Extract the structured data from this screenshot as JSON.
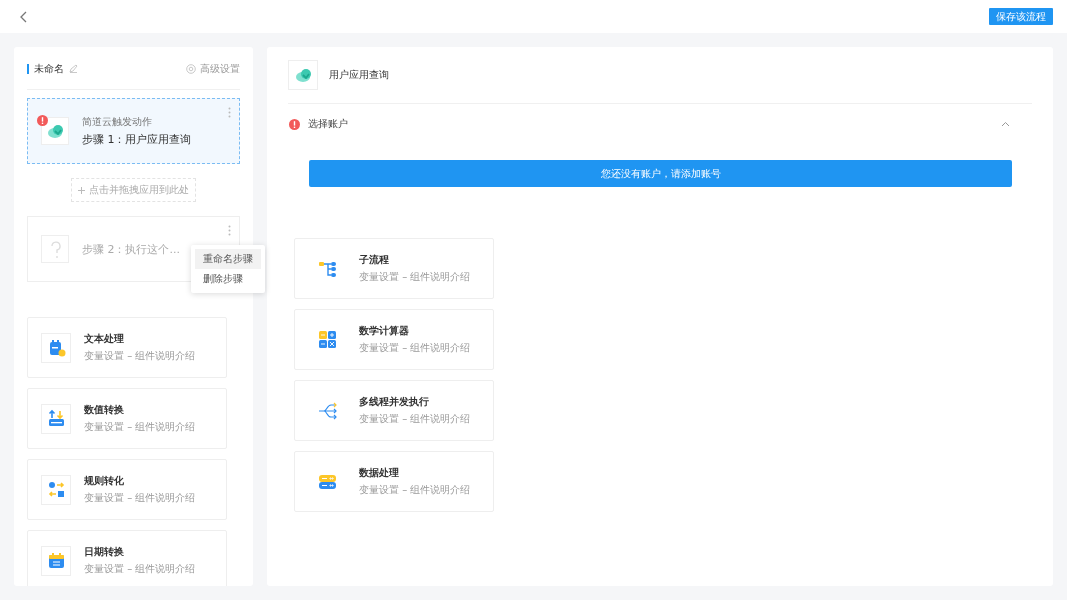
{
  "header": {
    "save_button": "保存该流程"
  },
  "flow": {
    "name": "未命名",
    "settings_link": "高级设置",
    "steps": [
      {
        "kind": "app",
        "subtitle": "简道云触发动作",
        "title": "步骤 1：用户应用查询",
        "selected": true,
        "error": true
      },
      {
        "kind": "empty",
        "title": "步骤 2：执行这个...",
        "selected": false,
        "error": false,
        "menu": [
          {
            "label": "重命名步骤",
            "selected": true
          },
          {
            "label": "删除步骤",
            "selected": false
          }
        ]
      }
    ],
    "add_hint": "点击并拖拽应用到此处",
    "components": [
      {
        "kind": "text",
        "title": "文本处理",
        "desc": "变量设置 – 组件说明介绍"
      },
      {
        "kind": "number",
        "title": "数值转换",
        "desc": "变量设置 – 组件说明介绍"
      },
      {
        "kind": "rule",
        "title": "规则转化",
        "desc": "变量设置 – 组件说明介绍"
      },
      {
        "kind": "date",
        "title": "日期转换",
        "desc": "变量设置 – 组件说明介绍"
      }
    ]
  },
  "detail": {
    "title": "用户应用查询",
    "section": {
      "label": "选择账户",
      "error": true,
      "expanded": true
    },
    "banner": "您还没有账户，请添加账号",
    "components": [
      {
        "kind": "subflow",
        "title": "子流程",
        "desc": "变量设置 – 组件说明介绍"
      },
      {
        "kind": "calc",
        "title": "数学计算器",
        "desc": "变量设置 – 组件说明介绍"
      },
      {
        "kind": "thread",
        "title": "多线程并发执行",
        "desc": "变量设置 – 组件说明介绍"
      },
      {
        "kind": "data",
        "title": "数据处理",
        "desc": "变量设置 – 组件说明介绍"
      }
    ]
  }
}
